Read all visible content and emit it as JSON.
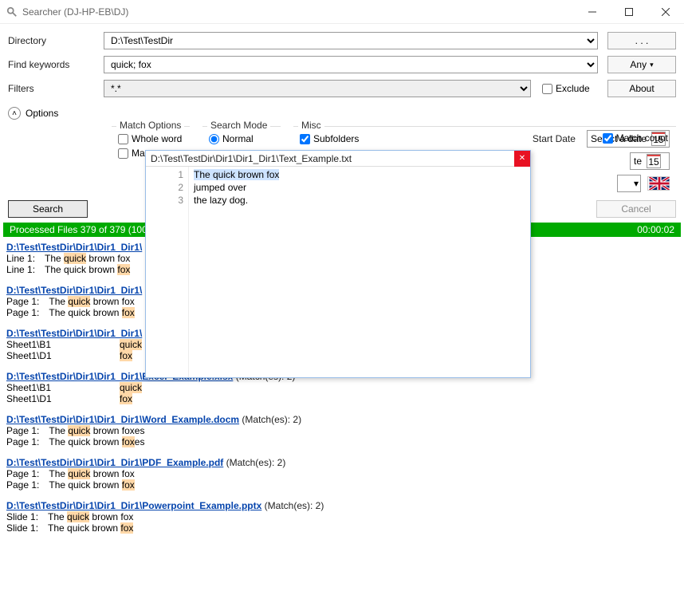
{
  "window": {
    "title": "Searcher (DJ-HP-EB\\DJ)"
  },
  "form": {
    "directory_label": "Directory",
    "directory_value": "D:\\Test\\TestDir",
    "browse_label": ". . .",
    "keywords_label": "Find keywords",
    "keywords_value": "quick; fox",
    "any_label": "Any",
    "filters_label": "Filters",
    "filters_value": "*.*",
    "exclude_label": "Exclude",
    "about_label": "About",
    "options_label": "Options"
  },
  "groups": {
    "match_options": {
      "title": "Match Options",
      "whole_word": "Whole word",
      "truncated": "Ma"
    },
    "search_mode": {
      "title": "Search Mode",
      "normal": "Normal"
    },
    "misc": {
      "title": "Misc",
      "subfolders": "Subfolders",
      "start_date": "Start Date",
      "select_date": "Select a date",
      "cal_num": "15",
      "te_partial": "te"
    },
    "match_count": "Match count"
  },
  "actions": {
    "search": "Search",
    "cancel": "Cancel"
  },
  "progress": {
    "text": "Processed Files 379 of 379 (100",
    "time": "00:00:02"
  },
  "preview": {
    "path": "D:\\Test\\TestDir\\Dir1\\Dir1_Dir1\\Text_Example.txt",
    "lines": [
      "1",
      "2",
      "3"
    ],
    "text": [
      "The quick brown fox",
      "jumped over",
      "the lazy dog."
    ]
  },
  "results": [
    {
      "path": "D:\\Test\\TestDir\\Dir1\\Dir1_Dir1\\",
      "matches": "",
      "rows": [
        {
          "loc": "Line 1:",
          "pre": "The ",
          "hl": "quick",
          "post": " brown fox"
        },
        {
          "loc": "Line 1:",
          "pre": "The quick brown ",
          "hl": "fox",
          "post": ""
        }
      ]
    },
    {
      "path": "D:\\Test\\TestDir\\Dir1\\Dir1_Dir1\\",
      "matches": "",
      "rows": [
        {
          "loc": "Page 1:",
          "pre": "The ",
          "hl": "quick",
          "post": " brown fox"
        },
        {
          "loc": "Page 1:",
          "pre": "The quick brown ",
          "hl": "fox",
          "post": ""
        }
      ]
    },
    {
      "path": "D:\\Test\\TestDir\\Dir1\\Dir1_Dir1\\",
      "matches": "",
      "rows": [
        {
          "loc": "Sheet1\\B1",
          "pre": "",
          "hl": "quick",
          "post": "",
          "wide": true
        },
        {
          "loc": "Sheet1\\D1",
          "pre": "",
          "hl": "fox",
          "post": "",
          "wide": true
        }
      ]
    },
    {
      "path": "D:\\Test\\TestDir\\Dir1\\Dir1_Dir1\\Excel_Example.xlsx",
      "matches": " (Match(es): 2)",
      "rows": [
        {
          "loc": "Sheet1\\B1",
          "pre": "",
          "hl": "quick",
          "post": "",
          "wide": true
        },
        {
          "loc": "Sheet1\\D1",
          "pre": "",
          "hl": "fox",
          "post": "",
          "wide": true
        }
      ]
    },
    {
      "path": "D:\\Test\\TestDir\\Dir1\\Dir1_Dir1\\Word_Example.docm",
      "matches": " (Match(es): 2)",
      "rows": [
        {
          "loc": "Page 1:",
          "pre": "The ",
          "hl": "quick",
          "post": " brown foxes"
        },
        {
          "loc": "Page 1:",
          "pre": "The quick brown ",
          "hl": "fox",
          "post": "es"
        }
      ]
    },
    {
      "path": "D:\\Test\\TestDir\\Dir1\\Dir1_Dir1\\PDF_Example.pdf",
      "matches": " (Match(es): 2)",
      "rows": [
        {
          "loc": "Page 1:",
          "pre": "The ",
          "hl": "quick",
          "post": " brown fox"
        },
        {
          "loc": "Page 1:",
          "pre": "The quick brown ",
          "hl": "fox",
          "post": ""
        }
      ]
    },
    {
      "path": "D:\\Test\\TestDir\\Dir1\\Dir1_Dir1\\Powerpoint_Example.pptx",
      "matches": " (Match(es): 2)",
      "rows": [
        {
          "loc": "Slide 1:",
          "pre": "The ",
          "hl": "quick",
          "post": " brown fox"
        },
        {
          "loc": "Slide 1:",
          "pre": "The quick brown ",
          "hl": "fox",
          "post": ""
        }
      ]
    }
  ]
}
